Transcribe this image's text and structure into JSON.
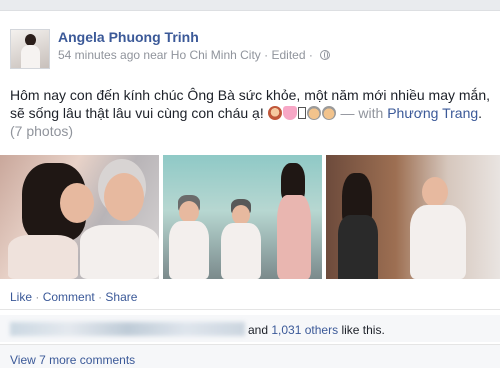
{
  "post": {
    "author": "Angela Phuong Trinh",
    "time": "54 minutes ago",
    "location_prefix": "near",
    "location": "Ho Chi Minh City",
    "edited": "Edited",
    "meta_sep": "·",
    "text": "Hôm nay con đến kính chúc Ông Bà sức khỏe, một năm mới nhiều may mắn, sẽ sống lâu thật lâu vui cùng con cháu ạ!",
    "with_prefix": "— with",
    "with_name": "Phương Trang",
    "with_suffix": ".",
    "photos_count": "(7 photos)",
    "emoji_icons": [
      "girl-emoji",
      "heart-emoji",
      "unknown-glyph",
      "old-woman-emoji",
      "old-man-emoji"
    ]
  },
  "actions": {
    "like": "Like",
    "comment": "Comment",
    "share": "Share",
    "sep": "·"
  },
  "likes": {
    "and": "and",
    "others": "1,031 others",
    "suffix": "like this."
  },
  "comments": {
    "view_more": "View 7 more comments"
  },
  "colors": {
    "link": "#3b5998",
    "meta": "#90949c",
    "text": "#1d2129",
    "background": "#e9ebee"
  }
}
